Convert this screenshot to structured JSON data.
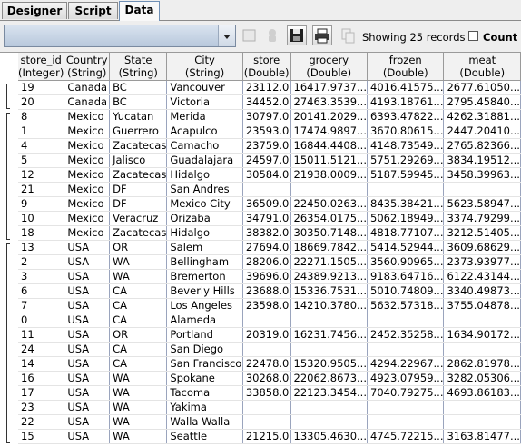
{
  "tabs": [
    {
      "label": "Designer",
      "active": false
    },
    {
      "label": "Script",
      "active": false
    },
    {
      "label": "Data",
      "active": true
    }
  ],
  "toolbar": {
    "query_value": "",
    "status_text": "Showing 25 records",
    "count_label": "Count A",
    "count_checked": false,
    "icons": [
      "square-icon",
      "hand-icon",
      "save-icon",
      "print-icon",
      "copy-icon"
    ]
  },
  "table": {
    "columns": [
      {
        "name": "store_id",
        "type": "(Integer)"
      },
      {
        "name": "Country",
        "type": "(String)"
      },
      {
        "name": "State",
        "type": "(String)"
      },
      {
        "name": "City",
        "type": "(String)"
      },
      {
        "name": "store",
        "type": "(Double)"
      },
      {
        "name": "grocery",
        "type": "(Double)"
      },
      {
        "name": "frozen",
        "type": "(Double)"
      },
      {
        "name": "meat",
        "type": "(Double)"
      }
    ],
    "rows": [
      [
        "19",
        "Canada",
        "BC",
        "Vancouver",
        "23112.0",
        "16417.9737...",
        "4016.41575...",
        "2677.61050..."
      ],
      [
        "20",
        "Canada",
        "BC",
        "Victoria",
        "34452.0",
        "27463.3539...",
        "4193.18761...",
        "2795.45840..."
      ],
      [
        "8",
        "Mexico",
        "Yucatan",
        "Merida",
        "30797.0",
        "20141.2029...",
        "6393.47822...",
        "4262.31881..."
      ],
      [
        "1",
        "Mexico",
        "Guerrero",
        "Acapulco",
        "23593.0",
        "17474.9897...",
        "3670.80615...",
        "2447.20410..."
      ],
      [
        "4",
        "Mexico",
        "Zacatecas",
        "Camacho",
        "23759.0",
        "16844.4408...",
        "4148.73549...",
        "2765.82366..."
      ],
      [
        "5",
        "Mexico",
        "Jalisco",
        "Guadalajara",
        "24597.0",
        "15011.5121...",
        "5751.29269...",
        "3834.19512..."
      ],
      [
        "12",
        "Mexico",
        "Zacatecas",
        "Hidalgo",
        "30584.0",
        "21938.0009...",
        "5187.59945...",
        "3458.39963..."
      ],
      [
        "21",
        "Mexico",
        "DF",
        "San Andres",
        "",
        "",
        "",
        ""
      ],
      [
        "9",
        "Mexico",
        "DF",
        "Mexico City",
        "36509.0",
        "22450.0263...",
        "8435.38421...",
        "5623.58947..."
      ],
      [
        "10",
        "Mexico",
        "Veracruz",
        "Orizaba",
        "34791.0",
        "26354.0175...",
        "5062.18949...",
        "3374.79299..."
      ],
      [
        "18",
        "Mexico",
        "Zacatecas",
        "Hidalgo",
        "38382.0",
        "30350.7148...",
        "4818.77107...",
        "3212.51405..."
      ],
      [
        "13",
        "USA",
        "OR",
        "Salem",
        "27694.0",
        "18669.7842...",
        "5414.52944...",
        "3609.68629..."
      ],
      [
        "2",
        "USA",
        "WA",
        "Bellingham",
        "28206.0",
        "22271.1505...",
        "3560.90965...",
        "2373.93977..."
      ],
      [
        "3",
        "USA",
        "WA",
        "Bremerton",
        "39696.0",
        "24389.9213...",
        "9183.64716...",
        "6122.43144..."
      ],
      [
        "6",
        "USA",
        "CA",
        "Beverly Hills",
        "23688.0",
        "15336.7531...",
        "5010.74809...",
        "3340.49873..."
      ],
      [
        "7",
        "USA",
        "CA",
        "Los Angeles",
        "23598.0",
        "14210.3780...",
        "5632.57318...",
        "3755.04878..."
      ],
      [
        "0",
        "USA",
        "CA",
        "Alameda",
        "",
        "",
        "",
        ""
      ],
      [
        "11",
        "USA",
        "OR",
        "Portland",
        "20319.0",
        "16231.7456...",
        "2452.35258...",
        "1634.90172..."
      ],
      [
        "24",
        "USA",
        "CA",
        "San Diego",
        "",
        "",
        "",
        ""
      ],
      [
        "14",
        "USA",
        "CA",
        "San Francisco",
        "22478.0",
        "15320.9505...",
        "4294.22967...",
        "2862.81978..."
      ],
      [
        "16",
        "USA",
        "WA",
        "Spokane",
        "30268.0",
        "22062.8673...",
        "4923.07959...",
        "3282.05306..."
      ],
      [
        "17",
        "USA",
        "WA",
        "Tacoma",
        "33858.0",
        "22123.3454...",
        "7040.79275...",
        "4693.86183..."
      ],
      [
        "23",
        "USA",
        "WA",
        "Yakima",
        "",
        "",
        "",
        ""
      ],
      [
        "22",
        "USA",
        "WA",
        "Walla Walla",
        "",
        "",
        "",
        ""
      ],
      [
        "15",
        "USA",
        "WA",
        "Seattle",
        "21215.0",
        "13305.4630...",
        "4745.72215...",
        "3163.81477..."
      ]
    ]
  }
}
